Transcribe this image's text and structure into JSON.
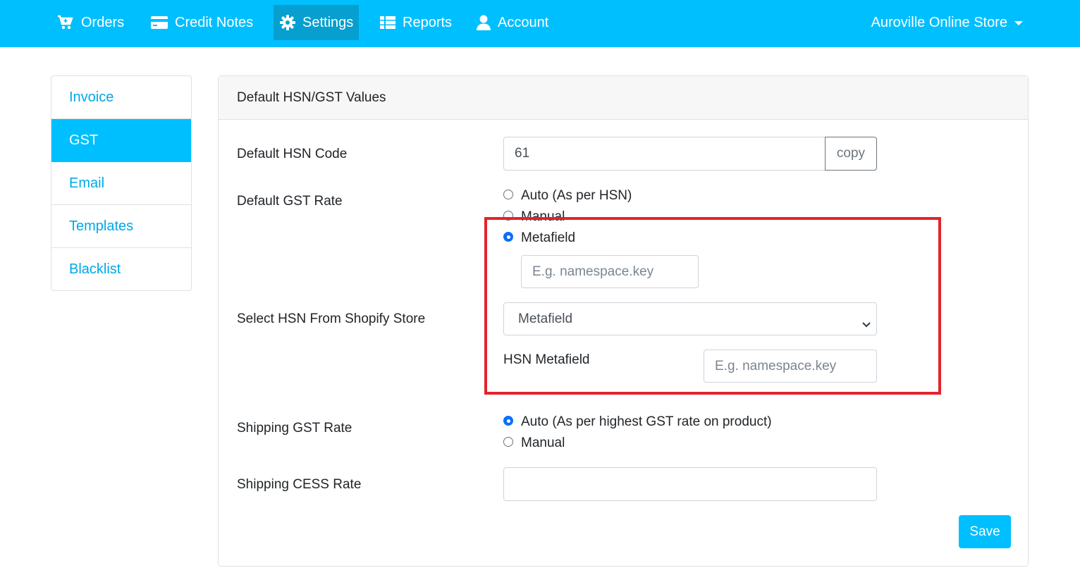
{
  "nav": {
    "items": [
      {
        "label": "Orders",
        "icon": "cart-icon"
      },
      {
        "label": "Credit Notes",
        "icon": "credit-card-icon"
      },
      {
        "label": "Settings",
        "icon": "gear-icon"
      },
      {
        "label": "Reports",
        "icon": "table-icon"
      },
      {
        "label": "Account",
        "icon": "user-icon"
      }
    ],
    "active": "Settings",
    "store_name": "Auroville Online Store",
    "bg_color": "#00bfff"
  },
  "sidebar": {
    "items": [
      {
        "label": "Invoice"
      },
      {
        "label": "GST"
      },
      {
        "label": "Email"
      },
      {
        "label": "Templates"
      },
      {
        "label": "Blacklist"
      }
    ],
    "active": "GST"
  },
  "card": {
    "title": "Default HSN/GST Values",
    "default_hsn": {
      "label": "Default HSN Code",
      "value": "61",
      "copy_label": "copy"
    },
    "default_gst_rate": {
      "label": "Default GST Rate",
      "options": [
        "Auto (As per HSN)",
        "Manual",
        "Metafield"
      ],
      "selected": "Metafield",
      "metafield_placeholder": "E.g. namespace.key"
    },
    "hsn_source": {
      "label": "Select HSN From Shopify Store",
      "selected": "Metafield",
      "metafield_label": "HSN Metafield",
      "metafield_placeholder": "E.g. namespace.key"
    },
    "shipping_gst_rate": {
      "label": "Shipping GST Rate",
      "options": [
        "Auto (As per highest GST rate on product)",
        "Manual"
      ],
      "selected": "Auto (As per highest GST rate on product)"
    },
    "shipping_cess_rate": {
      "label": "Shipping CESS Rate",
      "value": ""
    },
    "save_label": "Save"
  },
  "colors": {
    "accent": "#00bfff",
    "active_nav": "#069fcf",
    "highlight": "#e3232b",
    "radio_checked": "#0d6efd"
  }
}
